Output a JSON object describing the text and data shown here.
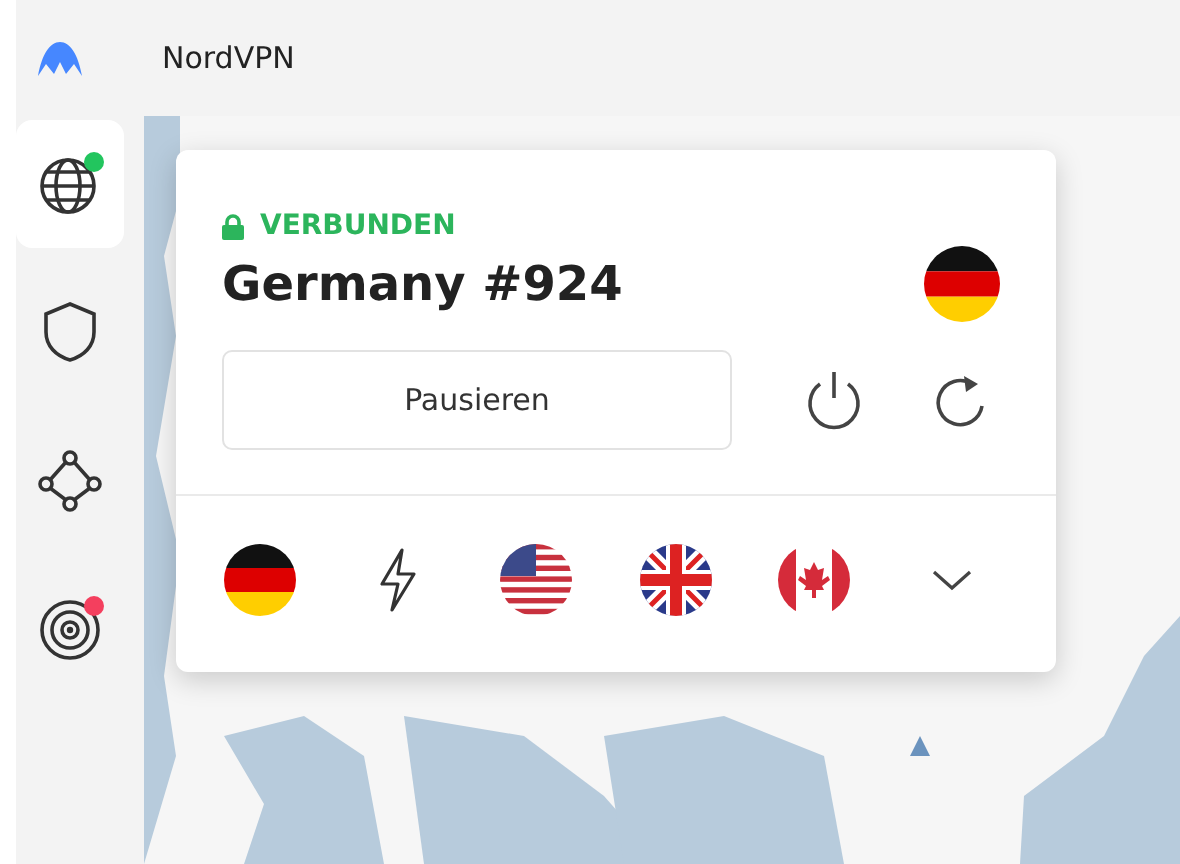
{
  "app": {
    "title": "NordVPN"
  },
  "sidebar": {
    "items": [
      {
        "kind": "globe",
        "selected": true,
        "color": "#22c55e"
      },
      {
        "kind": "shield",
        "selected": false
      },
      {
        "kind": "mesh",
        "selected": false
      },
      {
        "kind": "target",
        "selected": false,
        "color": "#f43f5e"
      }
    ]
  },
  "connection": {
    "status": "VERBUNDEN",
    "server": "Germany #924",
    "flag": {
      "kind": "de"
    },
    "pause_button": "Pausieren"
  },
  "quick_connect": [
    {
      "kind": "de"
    },
    {
      "kind": "bolt"
    },
    {
      "kind": "us"
    },
    {
      "kind": "gb"
    },
    {
      "kind": "ca"
    },
    {
      "kind": "more"
    }
  ]
}
